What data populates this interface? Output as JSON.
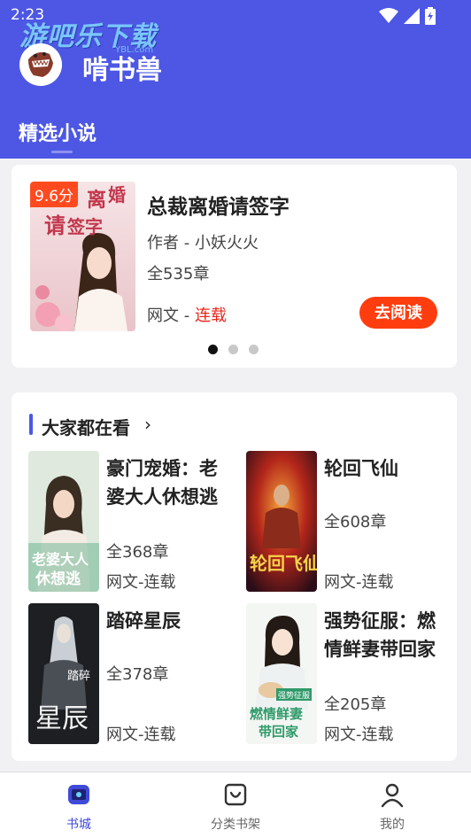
{
  "status_bar": {
    "time": "2:23"
  },
  "watermark": {
    "text": "游吧乐下载",
    "sub": "YBL.com"
  },
  "header": {
    "app_title": "啃书兽",
    "tab": "精选小说"
  },
  "featured": {
    "score": "9.6分",
    "title": "总裁离婚请签字",
    "author": "作者 - 小妖火火",
    "chapters": "全535章",
    "type_prefix": "网文 - ",
    "status": "连载",
    "read_button": "去阅读",
    "carousel_index": 0,
    "carousel_count": 3,
    "cover_art_text": "离婚请签字"
  },
  "popular": {
    "title": "大家都在看",
    "arrow": "›",
    "books": [
      {
        "title": "豪门宠婚：老婆大人休想逃",
        "chapters": "全368章",
        "type": "网文-连载",
        "cover_text": "老婆大人休想逃"
      },
      {
        "title": "轮回飞仙",
        "chapters": "全608章",
        "type": "网文-连载",
        "cover_text": "轮回飞仙"
      },
      {
        "title": "踏碎星辰",
        "chapters": "全378章",
        "type": "网文-连载",
        "cover_text": "踏碎星辰"
      },
      {
        "title": "强势征服：燃情鲜妻带回家",
        "chapters": "全205章",
        "type": "网文-连载",
        "cover_text": "燃情鲜妻带回家"
      }
    ]
  },
  "bottom_nav": [
    {
      "label": "书城",
      "icon": "bookstore-icon",
      "active": true
    },
    {
      "label": "分类书架",
      "icon": "shelf-icon",
      "active": false
    },
    {
      "label": "我的",
      "icon": "profile-icon",
      "active": false
    }
  ],
  "colors": {
    "brand": "#4d57e4",
    "accent": "#ff3d0f",
    "status_red": "#e8281e"
  }
}
